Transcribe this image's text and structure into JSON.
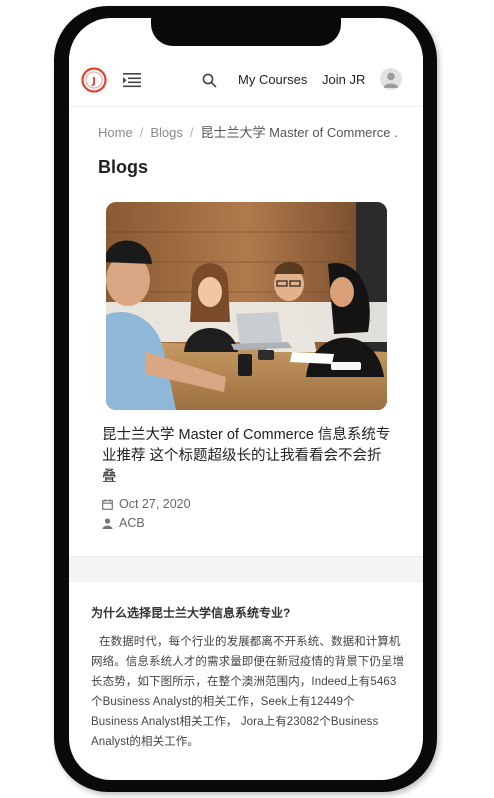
{
  "header": {
    "logo_icon": "jr-logo-icon",
    "menu_icon": "menu-toggle-icon",
    "search_icon": "search-icon",
    "my_courses_label": "My Courses",
    "join_label": "Join JR",
    "avatar_icon": "user-avatar-icon",
    "brand_color": "#e8402f"
  },
  "breadcrumb": {
    "home": "Home",
    "blogs": "Blogs",
    "current": "昆士兰大学 Master of Commerce ..."
  },
  "page": {
    "title": "Blogs"
  },
  "post": {
    "image_icon": "team-meeting-photo",
    "title": "昆士兰大学 Master of Commerce 信息系统专业推荐 这个标题超级长的让我看看会不会折叠",
    "date_icon": "calendar-icon",
    "date": "Oct 27, 2020",
    "author_icon": "user-icon",
    "author": "ACB"
  },
  "article": {
    "heading": "为什么选择昆士兰大学信息系统专业?",
    "body": "在数据时代，每个行业的发展都离不开系统、数据和计算机网络。信息系统人才的需求量即便在新冠疫情的背景下仍呈增长态势，如下图所示，在整个澳洲范围内，Indeed上有5463个Business Analyst的相关工作，Seek上有12449个 Business Analyst相关工作， Jora上有23082个Business Analyst的相关工作。"
  }
}
